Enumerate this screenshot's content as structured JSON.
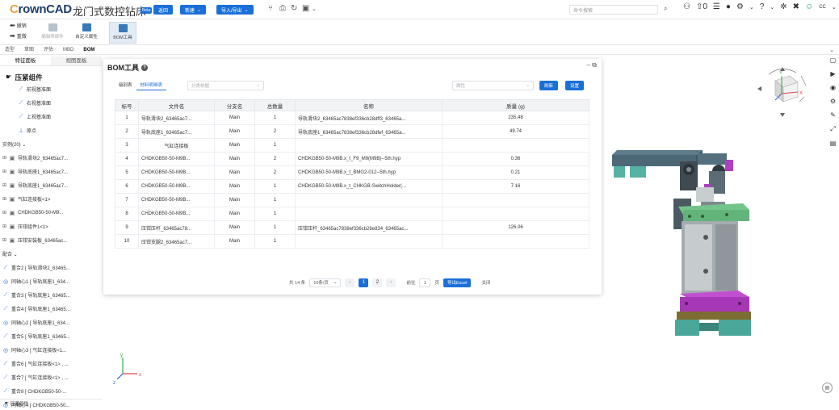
{
  "app": {
    "logo_prefix": "C",
    "logo_rest": "rownCAD",
    "title": "龙门式数控钻床",
    "badge": "Beta",
    "btn_back": "返回",
    "btn_new": "新建",
    "btn_io": "导入/导出"
  },
  "search": {
    "placeholder": "命令搜索"
  },
  "topright": {
    "notify_count": "0",
    "user": "CC"
  },
  "toolbar": {
    "undo": "撤销",
    "redo": "重做",
    "edit_part": "编辑零部件",
    "custom_attr": "自定义属性",
    "bom_tool": "BOM工具"
  },
  "tabs": [
    "造型",
    "草图",
    "评估",
    "MBD",
    "BOM"
  ],
  "active_tab": "BOM",
  "left_panel": {
    "tabs": [
      "特征面板",
      "视图面板"
    ],
    "root": "压紧组件",
    "items": [
      {
        "icon": "plane",
        "label": "前视基准面",
        "indent": 1
      },
      {
        "icon": "plane",
        "label": "右视基准面",
        "indent": 1
      },
      {
        "icon": "plane",
        "label": "上视基准面",
        "indent": 1
      },
      {
        "icon": "origin",
        "label": "原点",
        "indent": 1
      },
      {
        "icon": "none",
        "label": "实例(20) ⌄",
        "indent": 0
      },
      {
        "icon": "part",
        "label": "导轨滑块2_63465ac7...",
        "indent": 0
      },
      {
        "icon": "part",
        "label": "导轨底座1_63465ac7...",
        "indent": 0
      },
      {
        "icon": "part",
        "label": "导轨底座1_63465ac7...",
        "indent": 0
      },
      {
        "icon": "part",
        "label": "气缸连接板<1>",
        "indent": 0
      },
      {
        "icon": "part",
        "label": "CHDKGB50-50-M9...",
        "indent": 0
      },
      {
        "icon": "part",
        "label": "压钳组件1<1>",
        "indent": 0
      },
      {
        "icon": "part",
        "label": "压钳安装板_63465ac...",
        "indent": 0
      },
      {
        "icon": "none",
        "label": "配合 ⌄",
        "indent": 0
      },
      {
        "icon": "coin",
        "label": "重合2 [ 导轨滑块2_63465...",
        "indent": 0
      },
      {
        "icon": "conc",
        "label": "同轴心1 [ 导轨底座1_634...",
        "indent": 0
      },
      {
        "icon": "coin",
        "label": "重合3 [ 导轨底座1_63465...",
        "indent": 0
      },
      {
        "icon": "coin",
        "label": "重合4 [ 导轨底座1_63465...",
        "indent": 0
      },
      {
        "icon": "conc",
        "label": "同轴心2 [ 导轨底座1_634...",
        "indent": 0
      },
      {
        "icon": "coin",
        "label": "重合5 [ 导轨底座1_63465...",
        "indent": 0
      },
      {
        "icon": "conc",
        "label": "同轴心3 [ 气缸连接板<1...",
        "indent": 0
      },
      {
        "icon": "coin",
        "label": "重合6 [ 气缸连接板<1> , ...",
        "indent": 0
      },
      {
        "icon": "coin",
        "label": "重合7 [ 气缸连接板<1> , ...",
        "indent": 0
      },
      {
        "icon": "coin",
        "label": "重合8 [ CHDKGB50-50-...",
        "indent": 0
      },
      {
        "icon": "conc",
        "label": "同轴心4 [ CHDKGB50-50...",
        "indent": 0
      }
    ],
    "bottom": "压紧组件"
  },
  "bom": {
    "title": "BOM工具",
    "win_controls": "– ⧉",
    "tabs": [
      "级别表",
      "材料明细表"
    ],
    "active_tab": "材料明细表",
    "category_placeholder": "分类依据",
    "attr_placeholder": "属性",
    "btn_refresh": "刷新",
    "btn_settings": "设置",
    "columns": [
      "标号",
      "文件名",
      "分支名",
      "总数量",
      "名称",
      "质量 (g)"
    ],
    "rows": [
      [
        "1",
        "导轨滑块2_63465ac7...",
        "Main",
        "1",
        "导轨滑块2_63465ac7838ef336cb28dff3_63465a...",
        "235.48"
      ],
      [
        "2",
        "导轨底座1_63465ac7...",
        "Main",
        "2",
        "导轨底座1_63465ac7838ef336cb28dfef_63465a...",
        "49.74"
      ],
      [
        "3",
        "气缸连接板",
        "Main",
        "1",
        "",
        ""
      ],
      [
        "4",
        "CHDKGB50-50-M9B...",
        "Main",
        "2",
        "CHDKGB50-50-M9B.x_t_F9_M9(M9B)--5th.hyp",
        "0.36"
      ],
      [
        "5",
        "CHDKGB50-50-M9B...",
        "Main",
        "2",
        "CHDKGB50-50-M9B.x_t_BMG2-012--5th.hyp",
        "0.21"
      ],
      [
        "6",
        "CHDKGB50-50-M9B...",
        "Main",
        "1",
        "CHDKGB50-50-M9B.x_t_CHKGB-SwitchHolder(...",
        "7.16"
      ],
      [
        "7",
        "CHDKGB50-50-M9B...",
        "Main",
        "1",
        "",
        ""
      ],
      [
        "8",
        "CHDKGB50-50-M9B...",
        "Main",
        "1",
        "",
        ""
      ],
      [
        "9",
        "压钳压杆_63465ac78...",
        "Main",
        "1",
        "压钳压杆_63465ac7838ef336cb28e834_63465ac...",
        "126.06"
      ],
      [
        "10",
        "压钳支腿2_63465ac7...",
        "Main",
        "1",
        "",
        ""
      ]
    ],
    "pager": {
      "total": "共 14 条",
      "page_size": "10条/页",
      "pages": [
        "1",
        "2"
      ],
      "current_page": "1",
      "goto_label": "前往",
      "goto_value": "1",
      "page_unit": "页",
      "export": "导出Excel",
      "close": "关闭"
    }
  },
  "viewcube": {
    "top": "上",
    "front": "前",
    "axis_x": "X",
    "axis_y": "Y"
  },
  "axes": {
    "x": "x",
    "y": "y",
    "z": "z"
  },
  "colors": {
    "accent": "#1a6fd8",
    "model_teal": "#4aa89a",
    "model_slate": "#5b7584",
    "model_purple": "#b13fc2",
    "model_gray": "#9aa3a6",
    "model_green": "#6cc07a",
    "model_brown": "#8a7a3c"
  }
}
